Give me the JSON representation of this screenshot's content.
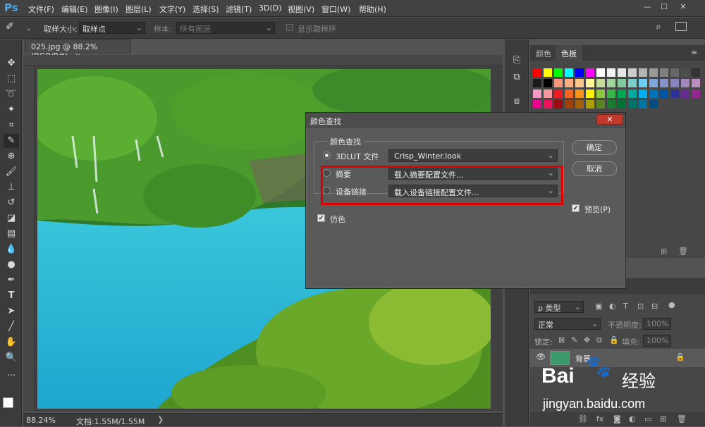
{
  "app": {
    "logo": "Ps"
  },
  "menu": [
    "文件(F)",
    "编辑(E)",
    "图像(I)",
    "图层(L)",
    "文字(Y)",
    "选择(S)",
    "滤镜(T)",
    "3D(D)",
    "视图(V)",
    "窗口(W)",
    "帮助(H)"
  ],
  "options": {
    "sample_size_label": "取样大小:",
    "sample_size_value": "取样点",
    "sample_label": "样本:",
    "sample_value": "所有图层",
    "show_ring_label": "显示取样环"
  },
  "document": {
    "tab_title": "025.jpg @ 88.2%(RGB/8#)",
    "zoom": "88.24%",
    "doc_info": "文档:1.55M/1.55M"
  },
  "panels": {
    "color_tab": "颜色",
    "swatches_tab": "色板"
  },
  "layers": {
    "kind_label": "ρ 类型",
    "blend_mode": "正常",
    "opacity_label": "不透明度:",
    "opacity_value": "100%",
    "lock_label": "锁定:",
    "fill_label": "填充:",
    "fill_value": "100%",
    "layer_name": "背景"
  },
  "dialog": {
    "title": "颜色查找",
    "group_title": "颜色查找",
    "rows": [
      {
        "label": "3DLUT 文件",
        "value": "Crisp_Winter.look",
        "selected": true
      },
      {
        "label": "摘要",
        "value": "载入摘要配置文件...",
        "selected": false
      },
      {
        "label": "设备链接",
        "value": "载入设备链接配置文件...",
        "selected": false
      }
    ],
    "dither_label": "仿色",
    "ok_label": "确定",
    "cancel_label": "取消",
    "preview_label": "预览(P)"
  },
  "watermark": {
    "brand": "Bai",
    "brand2": "经验",
    "url": "jingyan.baidu.com"
  },
  "swatch_colors": [
    "#ff0000",
    "#ffff00",
    "#00ff00",
    "#00ffff",
    "#0000ff",
    "#ff00ff",
    "#ffffff",
    "#f2f2f2",
    "#e6e6e6",
    "#cccccc",
    "#b3b3b3",
    "#999999",
    "#808080",
    "#666666",
    "#4d4d4d",
    "#333333",
    "#1a1a1a",
    "#000000",
    "#f7977a",
    "#f9ad81",
    "#fdc68a",
    "#fff79a",
    "#c4df9b",
    "#a3d39c",
    "#82ca9d",
    "#7bcdc8",
    "#6ecff6",
    "#7ea7d8",
    "#8493ca",
    "#8882be",
    "#a187be",
    "#bc8dbf",
    "#f49ac2",
    "#f6989d",
    "#ed1c24",
    "#f26522",
    "#f7941d",
    "#fff200",
    "#8dc73f",
    "#39b54a",
    "#00a651",
    "#00a99d",
    "#00aeef",
    "#0072bc",
    "#0054a6",
    "#2e3192",
    "#662d91",
    "#92278f",
    "#ec008c",
    "#ed145b",
    "#9e0b0f",
    "#a0410d",
    "#a3620a",
    "#aba000",
    "#598527",
    "#197b30",
    "#007236",
    "#00746b",
    "#0076a3",
    "#004b80"
  ],
  "accent_colors": {
    "dialog_close": "#c0392b",
    "highlight_box": "#e00000",
    "selection": "#0078d7"
  }
}
